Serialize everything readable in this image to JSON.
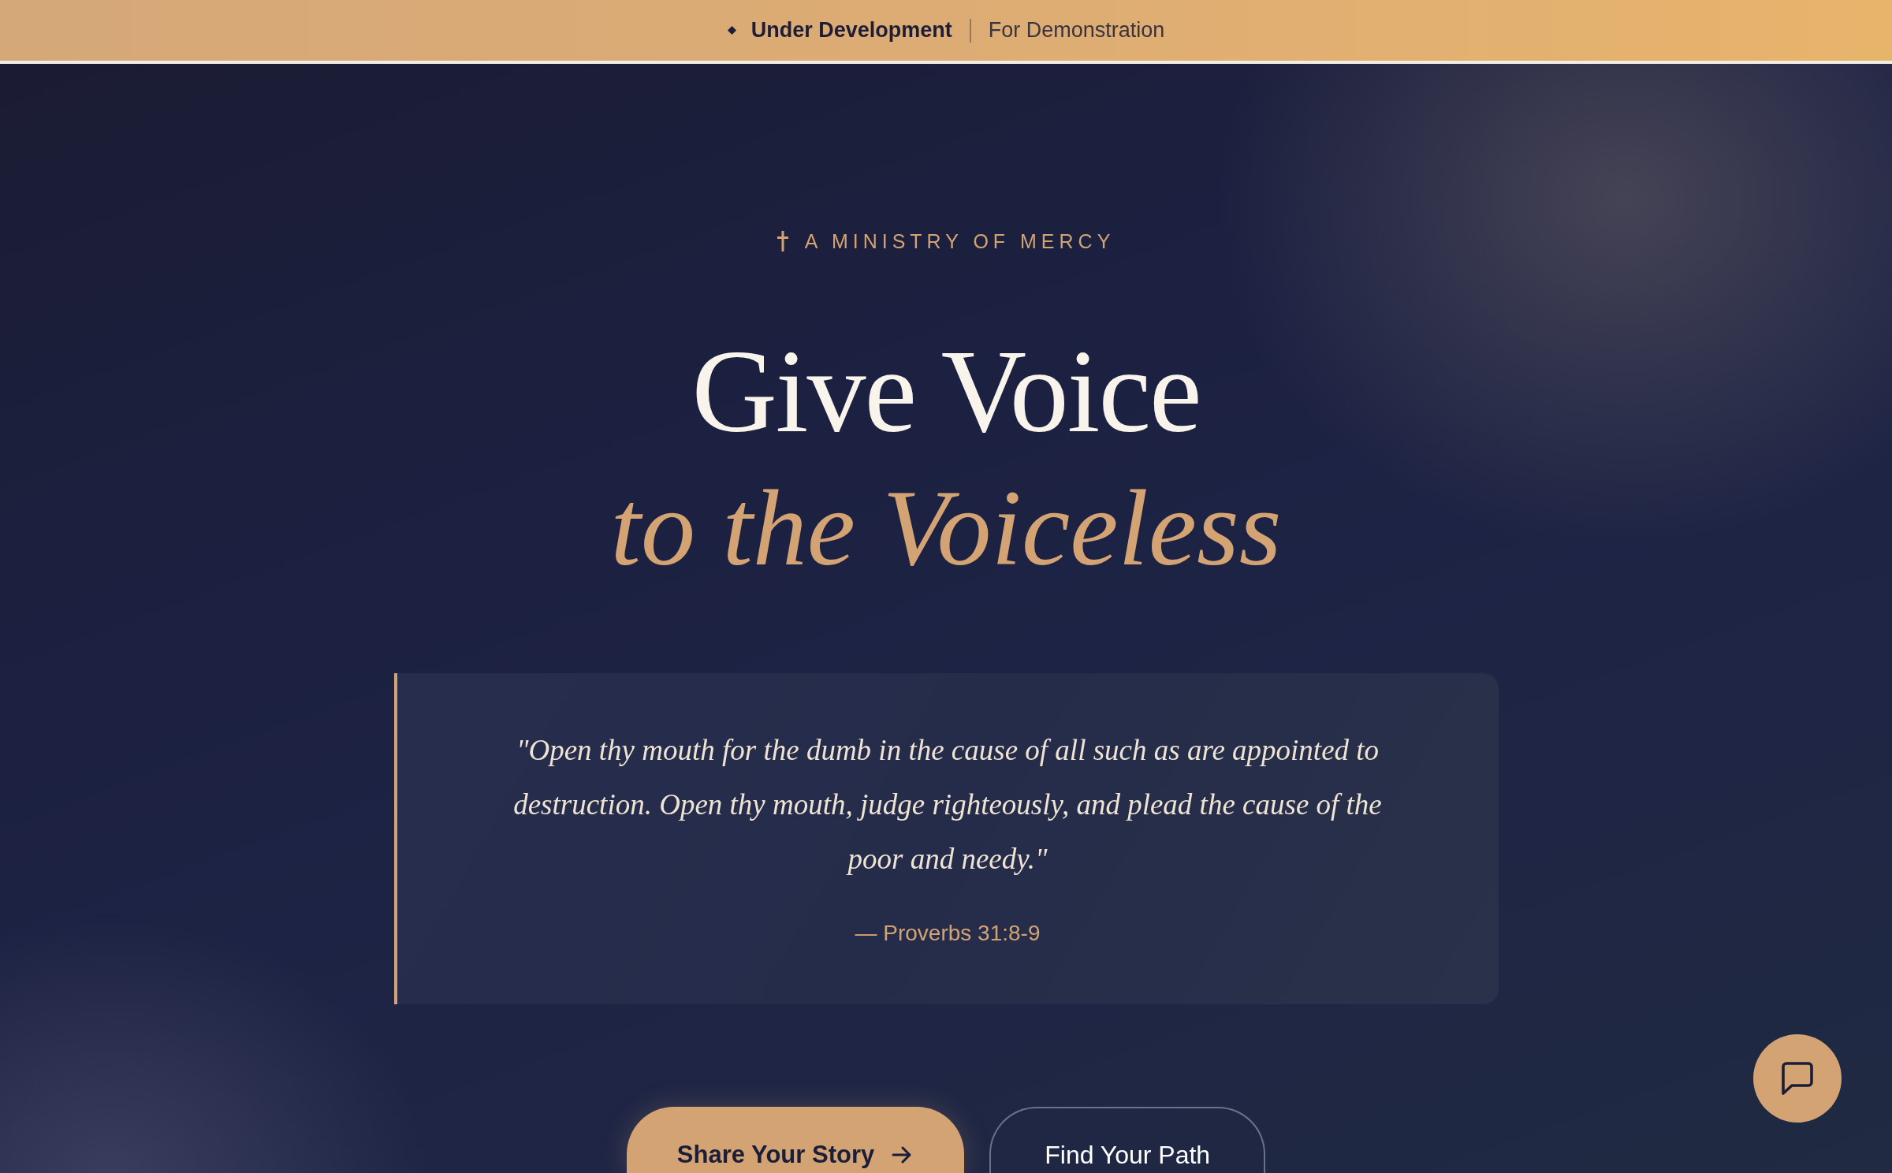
{
  "banner": {
    "status": "Under Development",
    "note": "For Demonstration"
  },
  "hero": {
    "eyebrow": "A MINISTRY OF MERCY",
    "title": "Give Voice",
    "title_accent": "to the Voiceless",
    "quote": {
      "text": "\"Open thy mouth for the dumb in the cause of all such as are appointed to destruction. Open thy mouth, judge righteously, and plead the cause of the poor and needy.\"",
      "citation": "— Proverbs 31:8-9"
    },
    "buttons": [
      {
        "label": "Share Your Story",
        "kind": "primary"
      },
      {
        "label": "Find Your Path",
        "kind": "outline"
      }
    ]
  }
}
